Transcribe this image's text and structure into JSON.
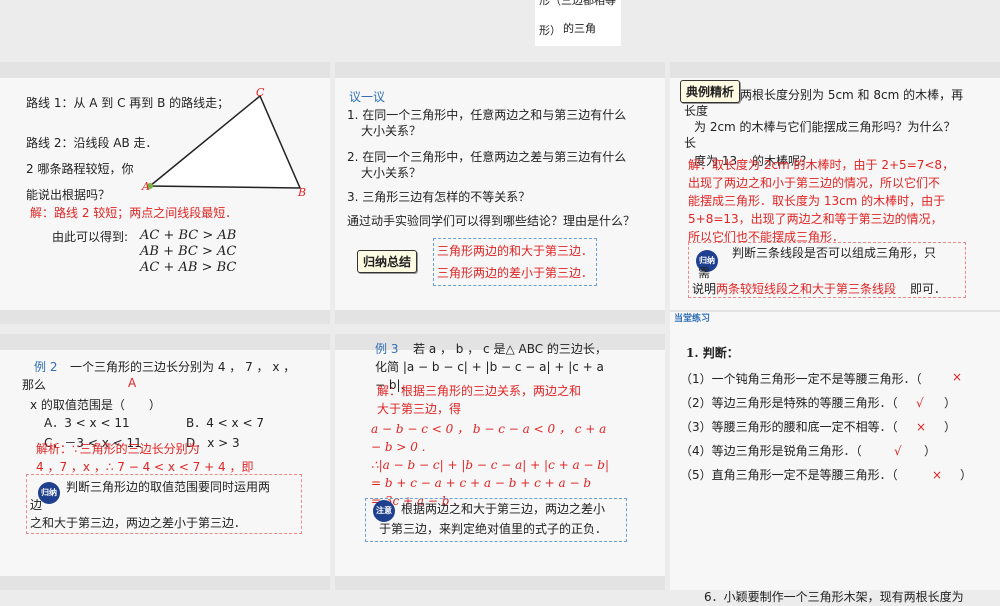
{
  "top": {
    "line1": "形（三边都相等",
    "line2": "形）",
    "line3": "的三角"
  },
  "s1": {
    "route1": "路线 1：从 A 到 C 再到 B 的路线走；",
    "route2": "路线 2：沿线段 AB 走．",
    "q1": "2 哪条路程较短，你",
    "q2": "能说出根据吗？",
    "answer": "解：路线 2 较短；两点之间线段最短．",
    "derive": "由此可以得到:",
    "ineq1": "AC + BC > AB",
    "ineq2": "AB + BC > AC",
    "ineq3": "AC + AB > BC",
    "label_a": "A",
    "label_b": "B",
    "label_c": "C"
  },
  "s2": {
    "title": "议一议",
    "q1a": "1. 在同一个三角形中，任意两边之和与第三边有什么",
    "q1b": "大小关系？",
    "q2a": "2. 在同一个三角形中，任意两边之差与第三边有什么",
    "q2b": "大小关系？",
    "q3": "3. 三角形三边有怎样的不等关系？",
    "q4": "通过动手实验同学们可以得到哪些结论？理由是什么？",
    "summary_tag": "归纳总结",
    "c1": "三角形两边的和大于第三边．",
    "c2": "三角形两边的差小于第三边．"
  },
  "s3": {
    "tag": "典例精析",
    "l1": "两根长度分别为 5cm 和 8cm 的木棒，再",
    "l2": "长度",
    "l3": "为 2cm 的木棒与它们能摆成三角形吗？为什么？",
    "l4": "长",
    "l5a": "度为 13",
    "l5b": "的木棒呢？",
    "a1": "解：取长度为 2cm 的木棒时，由于 2+5=7<8，",
    "a2": "出现了两边之和小于第三边的情况，所以它们不",
    "a3": "能摆成三角形．取长度为 13cm 的木棒时，由于",
    "a4": "5+8=13，出现了两边之和等于第三边的情况，",
    "a5": "所以它们也不能摆成三角形．",
    "note_badge": "归纳",
    "n1": "判断三条线段是否可以组成三角形，只",
    "n2": "需",
    "n3a": "说明",
    "n3b": "两条较短线段之和大于第三条线段",
    "n3c": "即可．"
  },
  "s4": {
    "ex": "例 2",
    "q1": "一个三角形的三边长分别为 4 ， 7 ， x ，",
    "q2": "那么",
    "ans_letter": "A",
    "q3": "x 的取值范围是（　　）",
    "optA": "A．3 < x < 11",
    "optB": "B．4 < x < 7",
    "optC": "C．－3 < x < 11",
    "optD": "D．x > 3",
    "sol1": "解析：∵三角形的三边长分别为",
    "sol2": "4 ，7 ，x ，∴ 7 − 4 < x < 7 + 4 ，即",
    "badge": "归纳",
    "n1": "判断三角形边的取值范围要同时运用两",
    "n2": "边",
    "n3": "之和大于第三边，两边之差小于第三边．"
  },
  "s5": {
    "ex": "例 3",
    "q1": "若 a ， b ， c 是△ ABC 的三边长，",
    "q2": "化简 |a − b − c| + |b − c − a| + |c + a",
    "q3": "− b|.",
    "s1": "解：根据三角形的三边关系，两边之和",
    "s2": "大于第三边，得",
    "s3": "a − b − c < 0 ， b − c − a < 0 ， c + a",
    "s4": "− b > 0 .",
    "s5": "∴|a − b − c| + |b − c − a| + |c + a − b|",
    "s6": "= b + c − a + c + a − b + c + a − b",
    "s7": "= 3c + a − b .",
    "badge": "注意",
    "n1": "根据两边之和大于第三边，两边之差小",
    "n2": "于第三边，来判定绝对值里的式子的正负．"
  },
  "s6": {
    "header": "当堂练习",
    "title": "1. 判断：",
    "items": [
      {
        "text": "（1）一个钝角三角形一定不是等腰三角形．（",
        "mark": "×"
      },
      {
        "text": "（2）等边三角形是特殊的等腰三角形．（",
        "mark": "√"
      },
      {
        "text": "（3）等腰三角形的腰和底一定不相等．（",
        "mark": "×"
      },
      {
        "text": "（4）等边三角形是锐角三角形．（",
        "mark": "√"
      },
      {
        "text": "（5）直角三角形一定不是等腰三角形．（",
        "mark": "×"
      }
    ],
    "close": "）"
  },
  "bottom": {
    "line": "6．小颖要制作一个三角形木架，现有两根长度为"
  }
}
